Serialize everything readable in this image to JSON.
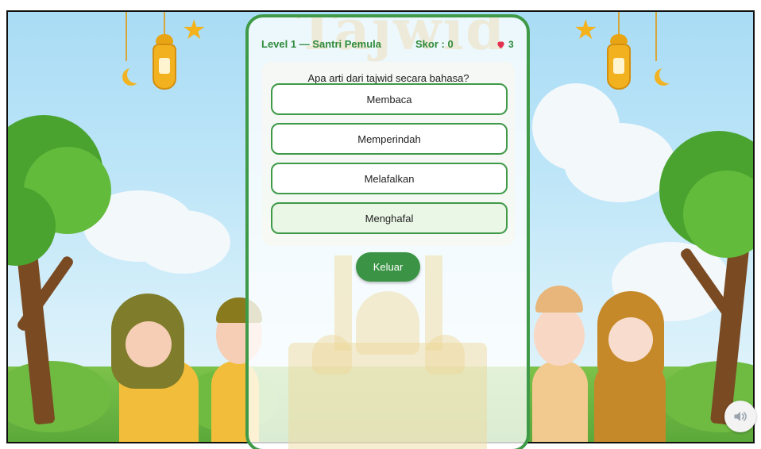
{
  "hud": {
    "level": "Level 1 — Santri Pemula",
    "score": "Skor : 0",
    "lives": "3"
  },
  "quiz": {
    "question": "Apa arti dari tajwid secara bahasa?",
    "options": [
      {
        "label": "Membaca"
      },
      {
        "label": "Memperindah"
      },
      {
        "label": "Melafalkan"
      },
      {
        "label": "Menghafal"
      }
    ]
  },
  "buttons": {
    "exit": "Keluar"
  },
  "background": {
    "title_watermark": "Tajwid"
  },
  "colors": {
    "accent": "#3f9a48",
    "heart": "#e2324f",
    "sky": "#a9dcf5"
  },
  "icons": [
    "heart-icon",
    "speaker-icon",
    "star-icon",
    "lantern-icon",
    "moon-icon"
  ]
}
